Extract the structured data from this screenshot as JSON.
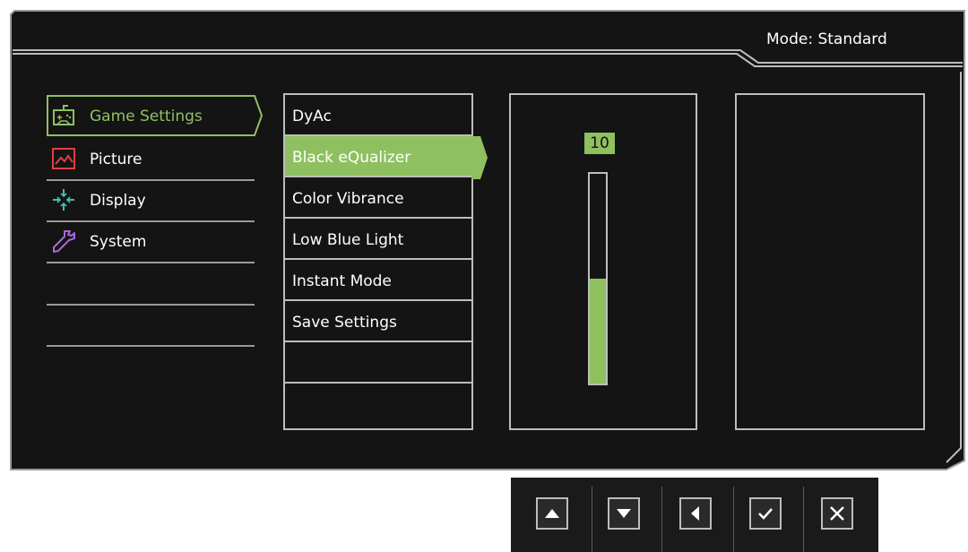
{
  "header": {
    "mode_label": "Mode: Standard"
  },
  "main_menu": [
    {
      "label": "Game Settings",
      "icon": "gamepad-icon",
      "active": true
    },
    {
      "label": "Picture",
      "icon": "picture-icon",
      "active": false
    },
    {
      "label": "Display",
      "icon": "display-icon",
      "active": false
    },
    {
      "label": "System",
      "icon": "wrench-icon",
      "active": false
    }
  ],
  "sub_menu": [
    {
      "label": "DyAc",
      "active": false
    },
    {
      "label": "Black eQualizer",
      "active": true
    },
    {
      "label": "Color Vibrance",
      "active": false
    },
    {
      "label": "Low Blue Light",
      "active": false
    },
    {
      "label": "Instant Mode",
      "active": false
    },
    {
      "label": "Save Settings",
      "active": false
    }
  ],
  "slider": {
    "value": "10",
    "level_fraction": 0.5
  },
  "nav_buttons": [
    {
      "icon": "up-arrow-icon"
    },
    {
      "icon": "down-arrow-icon"
    },
    {
      "icon": "left-arrow-icon"
    },
    {
      "icon": "check-icon"
    },
    {
      "icon": "close-icon"
    }
  ],
  "colors": {
    "accent": "#8fc060",
    "background": "#141414",
    "border": "#bdbdbd"
  }
}
